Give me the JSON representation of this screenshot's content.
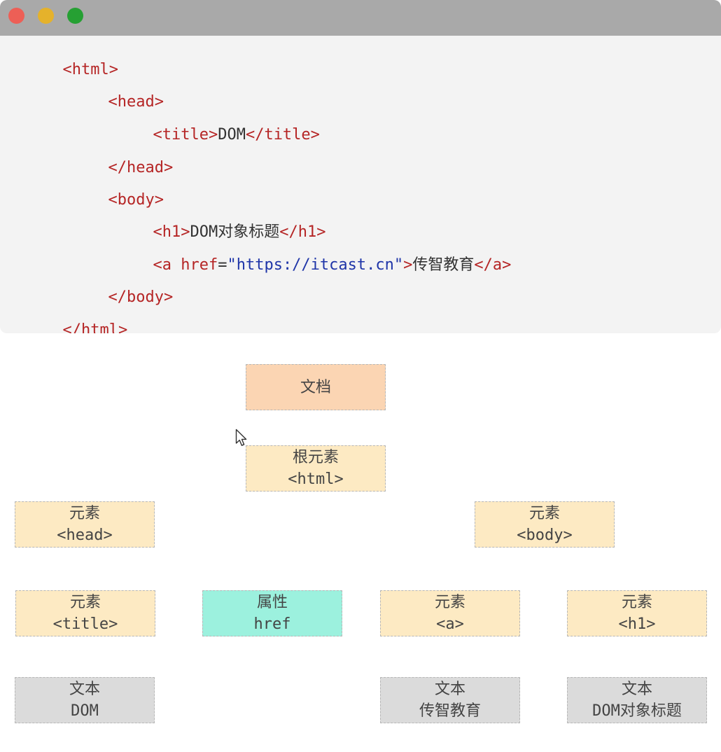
{
  "window": {
    "buttons": [
      {
        "name": "close",
        "color": "#ed5f56"
      },
      {
        "name": "minimize",
        "color": "#e5b22b"
      },
      {
        "name": "maximize",
        "color": "#26a033"
      }
    ]
  },
  "colors": {
    "tag": "#b52525",
    "attr_name": "#b52525",
    "attr_value": "#1f35a8",
    "text": "#333333",
    "document_node": "#fbd5b3",
    "element_node": "#fdeac3",
    "attribute_node": "#9cf1de",
    "text_node": "#dbdbdb"
  },
  "code": {
    "line1": {
      "open": "<html>"
    },
    "line2": {
      "open": "<head>"
    },
    "line3": {
      "open": "<title>",
      "text": "DOM",
      "close": "</title>"
    },
    "line4": {
      "close": "</head>"
    },
    "line5": {
      "open": "<body>"
    },
    "line6": {
      "open": "<h1>",
      "text": "DOM对象标题",
      "close": "</h1>"
    },
    "line7": {
      "open_start": "<a ",
      "attr_name": "href",
      "eq": "=",
      "attr_value": "\"https://itcast.cn\"",
      "open_end": ">",
      "text": "传智教育",
      "close": "</a>"
    },
    "line8": {
      "close": "</body>"
    },
    "line9": {
      "close": "</html>"
    }
  },
  "tree": {
    "document": {
      "line1": "文档"
    },
    "html": {
      "line1": "根元素",
      "line2": "<html>"
    },
    "head": {
      "line1": "元素",
      "line2": "<head>"
    },
    "body": {
      "line1": "元素",
      "line2": "<body>"
    },
    "title": {
      "line1": "元素",
      "line2": "<title>"
    },
    "href": {
      "line1": "属性",
      "line2": "href"
    },
    "a": {
      "line1": "元素",
      "line2": "<a>"
    },
    "h1": {
      "line1": "元素",
      "line2": "<h1>"
    },
    "text_dom": {
      "line1": "文本",
      "line2": "DOM"
    },
    "text_itcast": {
      "line1": "文本",
      "line2": "传智教育"
    },
    "text_title": {
      "line1": "文本",
      "line2": "DOM对象标题"
    }
  }
}
